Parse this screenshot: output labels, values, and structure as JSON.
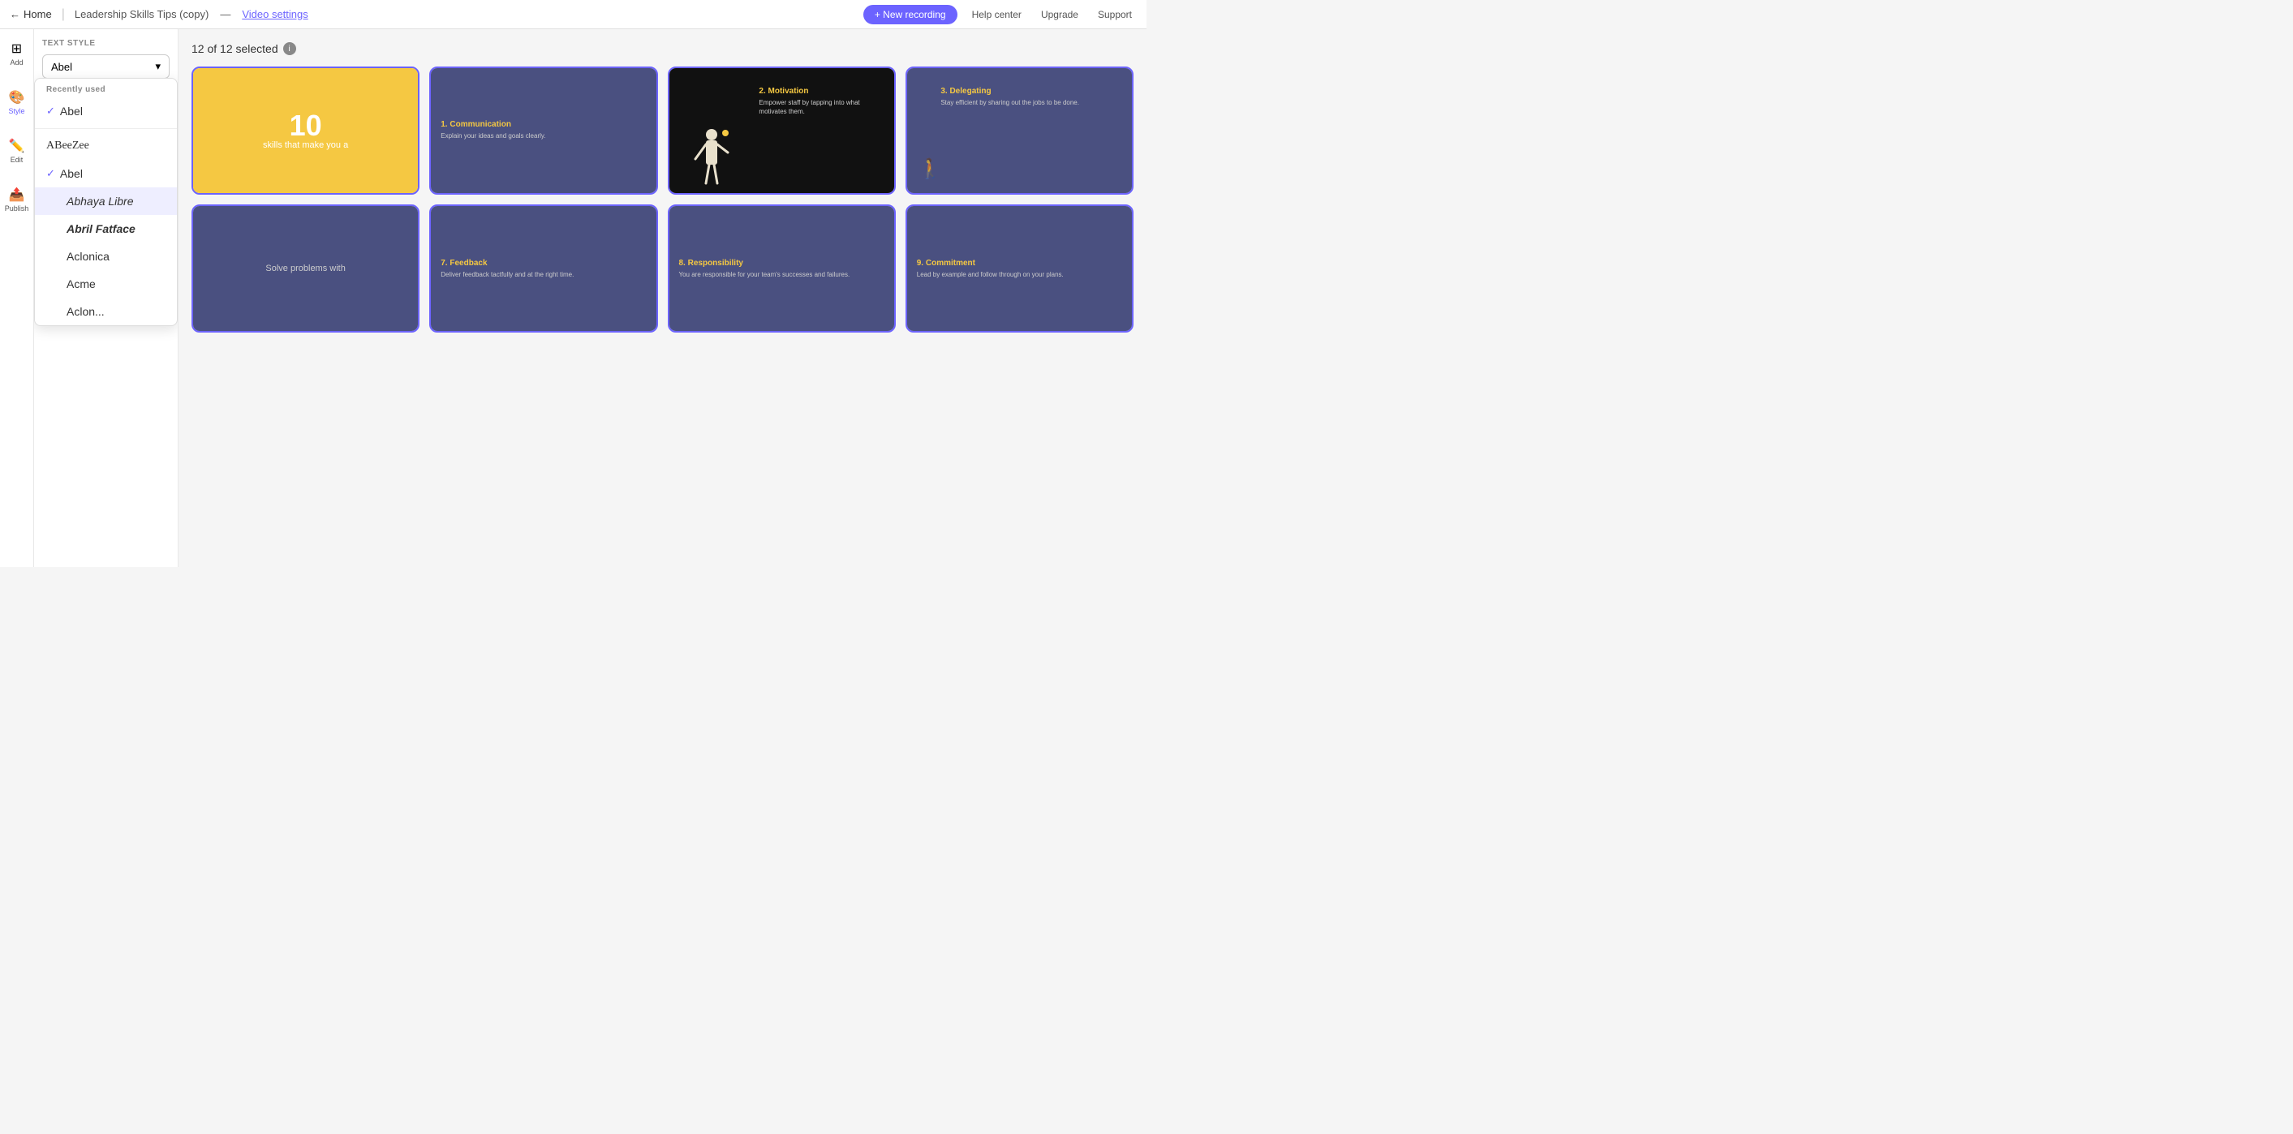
{
  "topNav": {
    "backLabel": "Home",
    "titleLabel": "Leadership Skills Tips (copy)",
    "separator": "—",
    "videoSettings": "Video settings",
    "newRecording": "+ New recording",
    "helpCenter": "Help center",
    "upgrade": "Upgrade",
    "support": "Support"
  },
  "sidebar": {
    "items": [
      {
        "id": "add",
        "label": "Add",
        "icon": "⊞"
      },
      {
        "id": "style",
        "label": "Style",
        "icon": "🎨"
      },
      {
        "id": "edit",
        "label": "Edit",
        "icon": "✏️"
      },
      {
        "id": "publish",
        "label": "Publish",
        "icon": "📤"
      }
    ]
  },
  "panel": {
    "textStyleLabel": "TEXT STYLE",
    "fontDropdown": {
      "currentFont": "Abel",
      "chevron": "▾"
    },
    "dropdown": {
      "recentlyUsedLabel": "Recently used",
      "recentFonts": [
        {
          "name": "Abel",
          "selected": true
        }
      ],
      "allFontsLabel": "",
      "fonts": [
        {
          "name": "ABeeZee",
          "class": "font-abeeZee",
          "selected": false,
          "hovered": false
        },
        {
          "name": "Abel",
          "class": "",
          "selected": true,
          "hovered": false
        },
        {
          "name": "Abhaya Libre",
          "class": "font-abhaya",
          "selected": false,
          "hovered": true
        },
        {
          "name": "Abril Fatface",
          "class": "font-abril",
          "selected": false,
          "hovered": false
        },
        {
          "name": "Aclonica",
          "class": "font-aclonica",
          "selected": false,
          "hovered": false
        },
        {
          "name": "Acme",
          "class": "font-acme",
          "selected": false,
          "hovered": false
        },
        {
          "name": "Aclon...",
          "class": "",
          "selected": false,
          "hovered": false
        }
      ]
    }
  },
  "content": {
    "selectionInfo": "12 of 12 selected",
    "infoIcon": "i",
    "slides": [
      {
        "id": "slide1",
        "type": "yellow",
        "bigNum": "10",
        "subText": "skills that make you a"
      },
      {
        "id": "slide2",
        "type": "blue",
        "title": "1. Communication",
        "desc": "Explain your ideas and goals clearly."
      },
      {
        "id": "slide3",
        "type": "dark-char",
        "title": "2. Motivation",
        "desc": "Empower staff by tapping into what motivates them."
      },
      {
        "id": "slide4",
        "type": "blue",
        "title": "3. Delegating",
        "desc": "Stay efficient by sharing out the jobs to be done."
      },
      {
        "id": "slide5",
        "type": "blue-center",
        "title": "",
        "desc": "Solve problems with"
      },
      {
        "id": "slide6",
        "type": "blue",
        "title": "7. Feedback",
        "desc": "Deliver feedback tactfully and at the right time."
      },
      {
        "id": "slide7",
        "type": "blue",
        "title": "8. Responsibility",
        "desc": "You are responsible for your team's successes and failures."
      },
      {
        "id": "slide8",
        "type": "blue",
        "title": "9. Commitment",
        "desc": "Lead by example and follow through on your plans."
      }
    ]
  }
}
